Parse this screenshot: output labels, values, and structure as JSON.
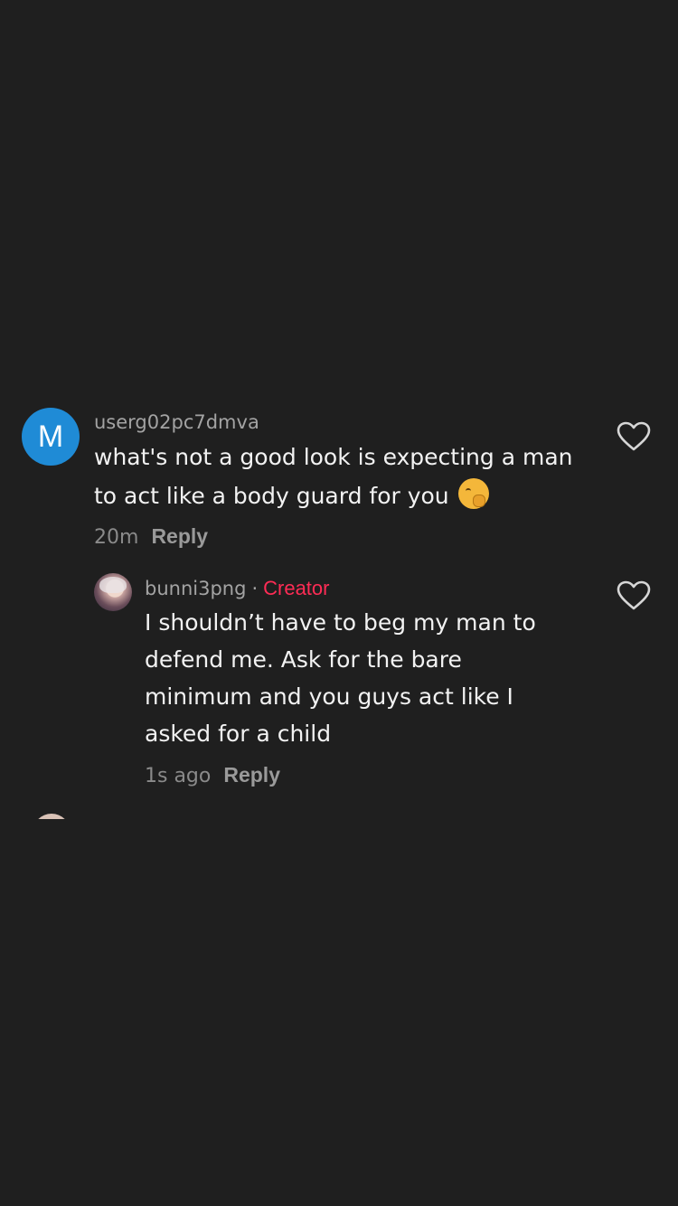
{
  "comment": {
    "avatar_letter": "M",
    "avatar_color": "#1f8bd6",
    "username": "userg02pc7dmva",
    "text": "what's not a good look is expecting a man to act like a body guard for you",
    "emoji_icon": "yawning-face-emoji",
    "time": "20m",
    "reply_label": "Reply"
  },
  "reply": {
    "username": "bunni3png",
    "separator": "·",
    "badge": "Creator",
    "badge_color": "#fe2c55",
    "text": "I shouldn’t have to beg my man to defend me. Ask for the bare minimum and you guys act like I asked for a child",
    "time": "1s ago",
    "reply_label": "Reply"
  },
  "icons": {
    "like": "heart-outline-icon"
  }
}
